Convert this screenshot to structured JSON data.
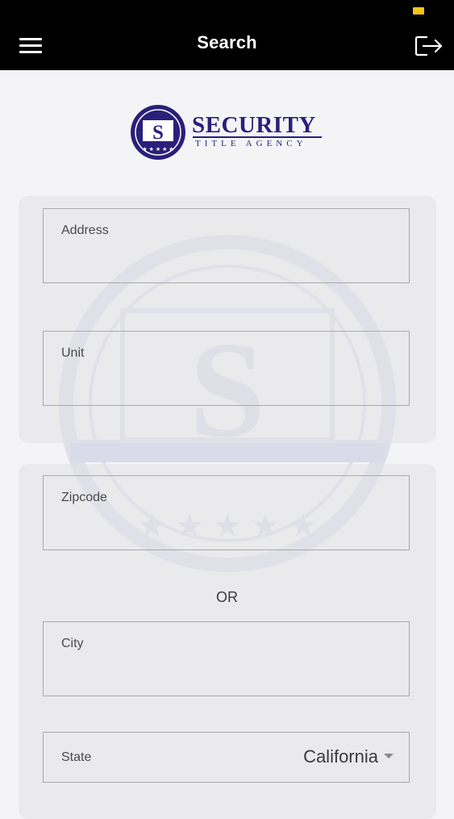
{
  "header": {
    "title": "Search",
    "menu_icon": "hamburger-menu-icon",
    "logout_icon": "logout-icon"
  },
  "logo": {
    "brand": "SECURITY",
    "tagline": "TITLE AGENCY",
    "emblem_letter": "S",
    "brand_color": "#2a1f7a"
  },
  "form": {
    "address_label": "Address",
    "unit_label": "Unit",
    "zipcode_label": "Zipcode",
    "or_text": "OR",
    "city_label": "City",
    "state_label": "State",
    "state_value": "California"
  },
  "colors": {
    "header_bg": "#000000",
    "battery": "#f5c518"
  }
}
